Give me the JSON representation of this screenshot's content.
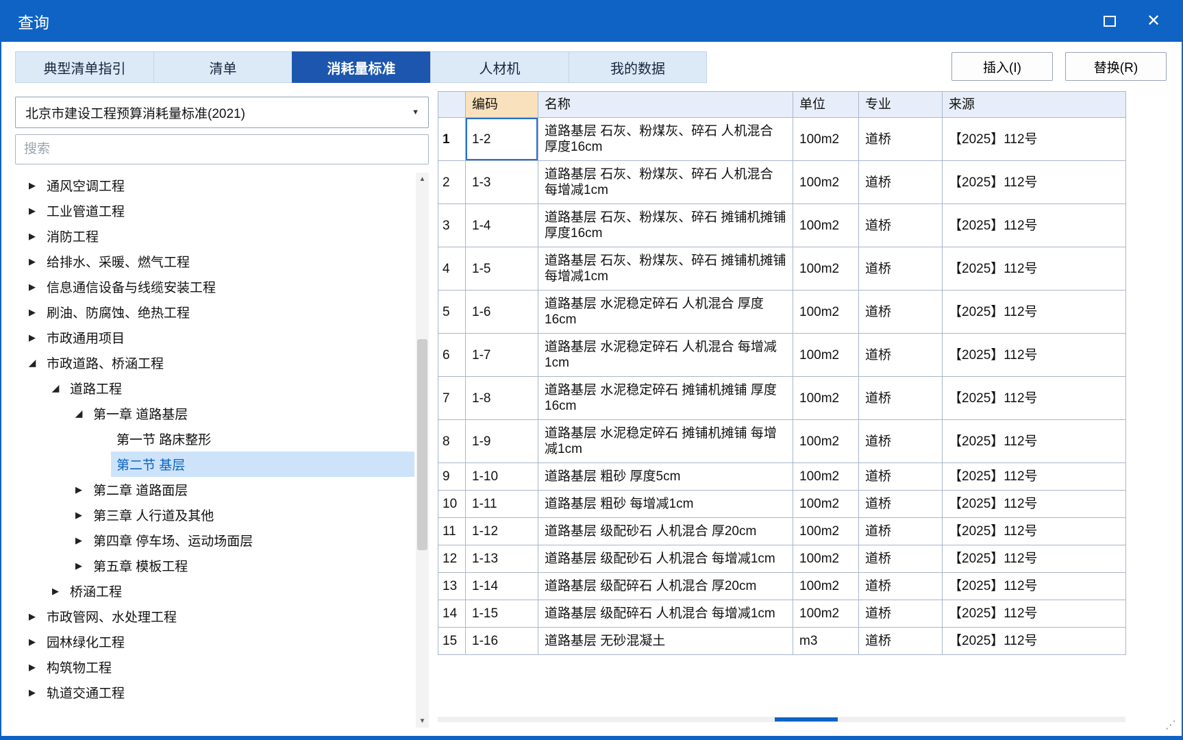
{
  "window": {
    "title": "查询",
    "close_glyph": "✕"
  },
  "tabs": [
    {
      "key": "typical-list-guide",
      "label": "典型清单指引",
      "active": false
    },
    {
      "key": "list",
      "label": "清单",
      "active": false
    },
    {
      "key": "consumption-standard",
      "label": "消耗量标准",
      "active": true
    },
    {
      "key": "labor-material-machine",
      "label": "人材机",
      "active": false
    },
    {
      "key": "my-data",
      "label": "我的数据",
      "active": false
    }
  ],
  "actions": {
    "insert": "插入(I)",
    "replace": "替换(R)"
  },
  "sidebar": {
    "standard": "北京市建设工程预算消耗量标准(2021)",
    "search_placeholder": "搜索",
    "tree": [
      {
        "label": "通风空调工程",
        "level": 0,
        "state": "collapsed"
      },
      {
        "label": "工业管道工程",
        "level": 0,
        "state": "collapsed"
      },
      {
        "label": "消防工程",
        "level": 0,
        "state": "collapsed"
      },
      {
        "label": "给排水、采暖、燃气工程",
        "level": 0,
        "state": "collapsed"
      },
      {
        "label": "信息通信设备与线缆安装工程",
        "level": 0,
        "state": "collapsed"
      },
      {
        "label": "刷油、防腐蚀、绝热工程",
        "level": 0,
        "state": "collapsed"
      },
      {
        "label": "市政通用项目",
        "level": 0,
        "state": "collapsed"
      },
      {
        "label": "市政道路、桥涵工程",
        "level": 0,
        "state": "expanded"
      },
      {
        "label": "道路工程",
        "level": 1,
        "state": "expanded"
      },
      {
        "label": "第一章 道路基层",
        "level": 2,
        "state": "expanded"
      },
      {
        "label": "第一节 路床整形",
        "level": 3,
        "state": "leaf"
      },
      {
        "label": "第二节 基层",
        "level": 3,
        "state": "leaf",
        "selected": true
      },
      {
        "label": "第二章 道路面层",
        "level": 2,
        "state": "collapsed"
      },
      {
        "label": "第三章 人行道及其他",
        "level": 2,
        "state": "collapsed"
      },
      {
        "label": "第四章 停车场、运动场面层",
        "level": 2,
        "state": "collapsed"
      },
      {
        "label": "第五章 模板工程",
        "level": 2,
        "state": "collapsed"
      },
      {
        "label": "桥涵工程",
        "level": 1,
        "state": "collapsed"
      },
      {
        "label": "市政管网、水处理工程",
        "level": 0,
        "state": "collapsed"
      },
      {
        "label": "园林绿化工程",
        "level": 0,
        "state": "collapsed"
      },
      {
        "label": "构筑物工程",
        "level": 0,
        "state": "collapsed"
      },
      {
        "label": "轨道交通工程",
        "level": 0,
        "state": "collapsed"
      }
    ]
  },
  "table": {
    "headers": {
      "num": "",
      "code": "编码",
      "name": "名称",
      "unit": "单位",
      "major": "专业",
      "source": "来源"
    },
    "rows": [
      {
        "num": "1",
        "code": "1-2",
        "name": "道路基层 石灰、粉煤灰、碎石 人机混合 厚度16cm",
        "unit": "100m2",
        "major": "道桥",
        "source": "【2025】112号"
      },
      {
        "num": "2",
        "code": "1-3",
        "name": "道路基层 石灰、粉煤灰、碎石 人机混合 每增减1cm",
        "unit": "100m2",
        "major": "道桥",
        "source": "【2025】112号"
      },
      {
        "num": "3",
        "code": "1-4",
        "name": "道路基层 石灰、粉煤灰、碎石 摊铺机摊铺 厚度16cm",
        "unit": "100m2",
        "major": "道桥",
        "source": "【2025】112号"
      },
      {
        "num": "4",
        "code": "1-5",
        "name": "道路基层 石灰、粉煤灰、碎石 摊铺机摊铺 每增减1cm",
        "unit": "100m2",
        "major": "道桥",
        "source": "【2025】112号"
      },
      {
        "num": "5",
        "code": "1-6",
        "name": "道路基层 水泥稳定碎石 人机混合 厚度16cm",
        "unit": "100m2",
        "major": "道桥",
        "source": "【2025】112号"
      },
      {
        "num": "6",
        "code": "1-7",
        "name": "道路基层 水泥稳定碎石 人机混合 每增减1cm",
        "unit": "100m2",
        "major": "道桥",
        "source": "【2025】112号"
      },
      {
        "num": "7",
        "code": "1-8",
        "name": "道路基层 水泥稳定碎石 摊铺机摊铺 厚度16cm",
        "unit": "100m2",
        "major": "道桥",
        "source": "【2025】112号"
      },
      {
        "num": "8",
        "code": "1-9",
        "name": "道路基层 水泥稳定碎石 摊铺机摊铺 每增减1cm",
        "unit": "100m2",
        "major": "道桥",
        "source": "【2025】112号"
      },
      {
        "num": "9",
        "code": "1-10",
        "name": "道路基层 粗砂 厚度5cm",
        "unit": "100m2",
        "major": "道桥",
        "source": "【2025】112号"
      },
      {
        "num": "10",
        "code": "1-11",
        "name": "道路基层 粗砂 每增减1cm",
        "unit": "100m2",
        "major": "道桥",
        "source": "【2025】112号"
      },
      {
        "num": "11",
        "code": "1-12",
        "name": "道路基层 级配砂石 人机混合 厚20cm",
        "unit": "100m2",
        "major": "道桥",
        "source": "【2025】112号"
      },
      {
        "num": "12",
        "code": "1-13",
        "name": "道路基层 级配砂石 人机混合 每增减1cm",
        "unit": "100m2",
        "major": "道桥",
        "source": "【2025】112号"
      },
      {
        "num": "13",
        "code": "1-14",
        "name": "道路基层 级配碎石 人机混合 厚20cm",
        "unit": "100m2",
        "major": "道桥",
        "source": "【2025】112号"
      },
      {
        "num": "14",
        "code": "1-15",
        "name": "道路基层 级配碎石 人机混合 每增减1cm",
        "unit": "100m2",
        "major": "道桥",
        "source": "【2025】112号"
      },
      {
        "num": "15",
        "code": "1-16",
        "name": "道路基层 无砂混凝土",
        "unit": "m3",
        "major": "道桥",
        "source": "【2025】112号"
      }
    ]
  },
  "colors": {
    "accent": "#0f63c5",
    "tab_active": "#1d56ae",
    "tab_inactive_bg": "#dceaf8",
    "selection_bg": "#cde3fa",
    "selection_fg": "#0b63c6",
    "code_header_bg": "#f9e1bd",
    "header_bg": "#e7eef9",
    "grid": "#a9b6ca",
    "focus": "#2a6fd2"
  }
}
